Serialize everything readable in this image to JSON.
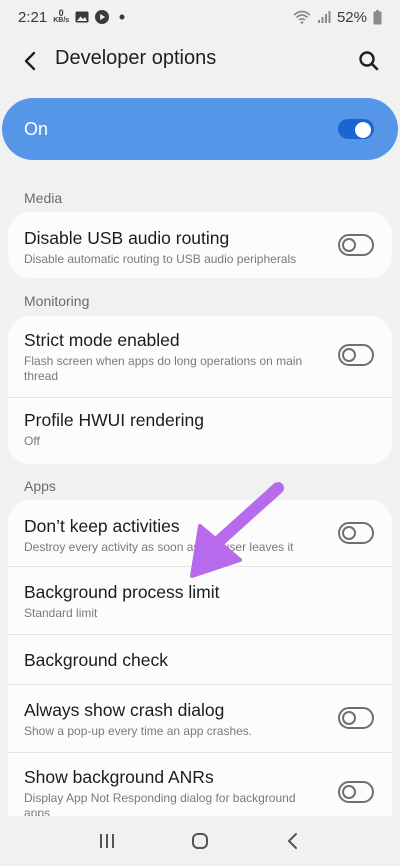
{
  "status_bar": {
    "time": "2:21",
    "kbps_value": "0",
    "kbps_unit": "KB/s",
    "battery": "52%"
  },
  "header": {
    "title": "Developer options"
  },
  "master_switch": {
    "label": "On",
    "state": true,
    "color": "#5596e8"
  },
  "sections": {
    "media": "Media",
    "monitoring": "Monitoring",
    "apps": "Apps"
  },
  "media_items": [
    {
      "title": "Disable USB audio routing",
      "subtitle": "Disable automatic routing to USB audio peripherals",
      "toggle": false
    }
  ],
  "monitoring_items": [
    {
      "title": "Strict mode enabled",
      "subtitle": "Flash screen when apps do long operations on main thread",
      "toggle": false
    },
    {
      "title": "Profile HWUI rendering",
      "subtitle": "Off"
    }
  ],
  "apps_items": [
    {
      "title": "Don’t keep activities",
      "subtitle": "Destroy every activity as soon as the user leaves it",
      "toggle": false
    },
    {
      "title": "Background process limit",
      "subtitle": "Standard limit"
    },
    {
      "title": "Background check"
    },
    {
      "title": "Always show crash dialog",
      "subtitle": "Show a pop-up every time an app crashes.",
      "toggle": false
    },
    {
      "title": "Show background ANRs",
      "subtitle": "Display App Not Responding dialog for background apps",
      "toggle": false
    }
  ],
  "annotation": {
    "color": "#b76bec"
  }
}
